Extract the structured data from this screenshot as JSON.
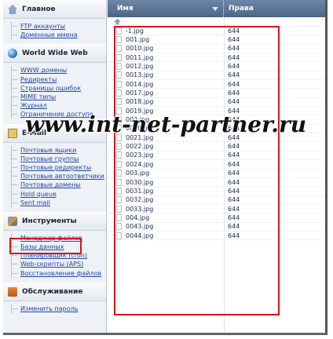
{
  "sidebar": {
    "sections": [
      {
        "title": "Главное",
        "icon": "home-icon",
        "items": [
          "FTP аккаунты",
          "Доменные имена"
        ]
      },
      {
        "title": "World Wide Web",
        "icon": "globe-icon",
        "items": [
          "WWW домены",
          "Редиректы",
          "Страницы ошибок",
          "MIME типы",
          "Журнал",
          "Ограничение доступа"
        ]
      },
      {
        "title": "E-Mail",
        "icon": "mail-icon",
        "items": [
          "Почтовые ящики",
          "Почтовые группы",
          "Почтовые редиректы",
          "Почтовые автоответчики",
          "Почтовые домены",
          "Hold queue",
          "Sent mail"
        ]
      },
      {
        "title": "Инструменты",
        "icon": "tools-icon",
        "items": [
          "Менеджер файлов",
          "Базы данных",
          "Планировщик (cron)",
          "Web-скрипты (APS)",
          "Восстановление файлов"
        ]
      },
      {
        "title": "Обслуживание",
        "icon": "service-icon",
        "items": [
          "Изменить пароль"
        ]
      }
    ]
  },
  "grid": {
    "col_name": "Имя",
    "col_perm": "Права",
    "files": [
      {
        "name": "-1.jpg",
        "perm": "644"
      },
      {
        "name": "001.jpg",
        "perm": "644"
      },
      {
        "name": "0010.jpg",
        "perm": "644"
      },
      {
        "name": "0011.jpg",
        "perm": "644"
      },
      {
        "name": "0012.jpg",
        "perm": "644"
      },
      {
        "name": "0013.jpg",
        "perm": "644"
      },
      {
        "name": "0014.jpg",
        "perm": "644"
      },
      {
        "name": "0017.jpg",
        "perm": "644"
      },
      {
        "name": "0018.jpg",
        "perm": "644"
      },
      {
        "name": "0019.jpg",
        "perm": "644"
      },
      {
        "name": "002.jpg",
        "perm": "644"
      },
      {
        "name": "0020.jpg",
        "perm": "644"
      },
      {
        "name": "0021.jpg",
        "perm": "644"
      },
      {
        "name": "0022.jpg",
        "perm": "644"
      },
      {
        "name": "0023.jpg",
        "perm": "644"
      },
      {
        "name": "0024.jpg",
        "perm": "644"
      },
      {
        "name": "003.jpg",
        "perm": "644"
      },
      {
        "name": "0030.jpg",
        "perm": "644"
      },
      {
        "name": "0031.jpg",
        "perm": "644"
      },
      {
        "name": "0032.jpg",
        "perm": "644"
      },
      {
        "name": "0033.jpg",
        "perm": "644"
      },
      {
        "name": "004.jpg",
        "perm": "644"
      },
      {
        "name": "0043.jpg",
        "perm": "644"
      },
      {
        "name": "0044.jpg",
        "perm": "644"
      }
    ]
  },
  "watermark": "www.int-net-partner.ru"
}
